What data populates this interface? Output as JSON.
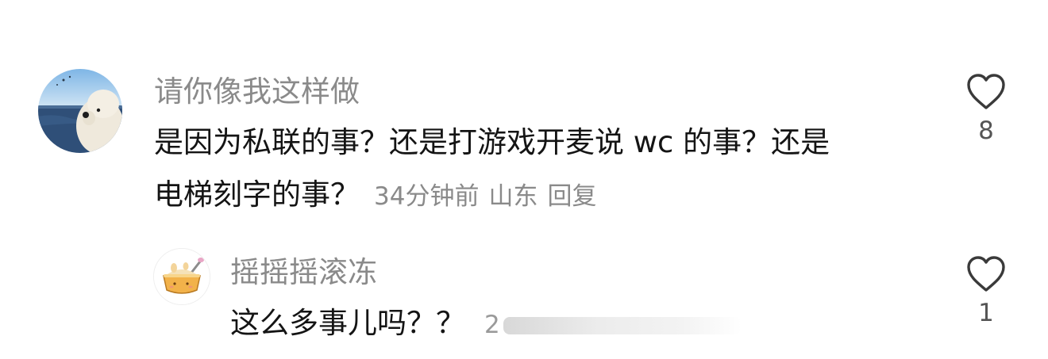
{
  "comments": [
    {
      "username": "请你像我这样做",
      "text_line1": "是因为私联的事？还是打游戏开麦说 wc 的事？还是",
      "text_line2": "电梯刻字的事？",
      "time": "34分钟前",
      "location": "山东",
      "reply_label": "回复",
      "likes": "8",
      "avatar_icon": "sea-plush-dog-avatar"
    },
    {
      "username": "摇摇摇滚冻",
      "text": "这么多事儿吗？？",
      "blurred_meta_start": "2",
      "likes": "1",
      "avatar_icon": "pudding-cup-avatar"
    }
  ],
  "icons": {
    "like": "heart-outline-icon"
  },
  "colors": {
    "username": "#8a8a8a",
    "text": "#141414",
    "meta": "#8a8a8a"
  }
}
